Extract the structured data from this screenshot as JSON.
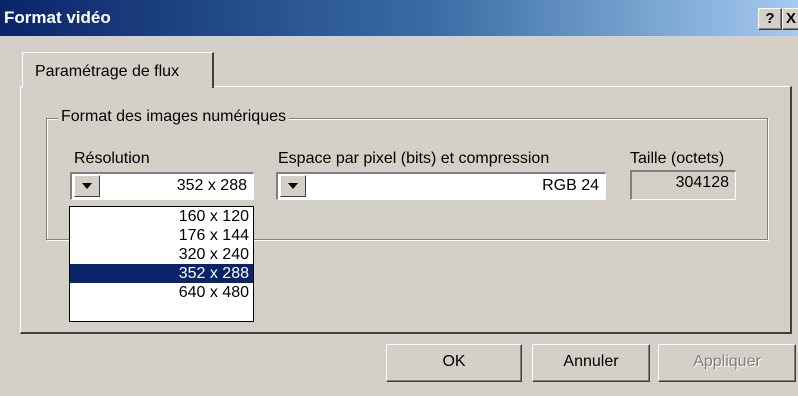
{
  "window": {
    "title": "Format vidéo",
    "help_label": "?",
    "close_label": "X"
  },
  "tabs": [
    {
      "label": "Paramétrage de flux",
      "active": true
    }
  ],
  "group": {
    "title": "Format des images numériques",
    "resolution": {
      "label": "Résolution",
      "value": "352 x 288",
      "options": [
        "160 x 120",
        "176 x 144",
        "320 x 240",
        "352 x 288",
        "640 x 480"
      ],
      "selected_index": 3
    },
    "pixel_space": {
      "label": "Espace par pixel (bits) et compression",
      "value": "RGB 24"
    },
    "size": {
      "label": "Taille (octets)",
      "value": "304128"
    }
  },
  "buttons": {
    "ok": "OK",
    "cancel": "Annuler",
    "apply": "Appliquer"
  },
  "colors": {
    "title_bar": "#0a246a",
    "selection": "#0a246a",
    "face": "#d4d0c8"
  }
}
